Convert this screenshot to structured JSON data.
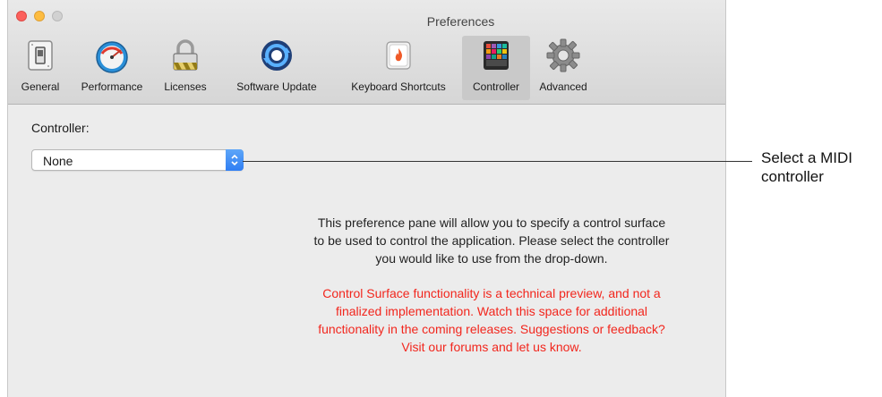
{
  "window": {
    "title": "Preferences"
  },
  "toolbar": {
    "items": [
      {
        "label": "General",
        "icon": "toggle-switch-icon"
      },
      {
        "label": "Performance",
        "icon": "speedometer-icon"
      },
      {
        "label": "Licenses",
        "icon": "padlock-icon"
      },
      {
        "label": "Software Update",
        "icon": "refresh-arrows-icon"
      },
      {
        "label": "Keyboard Shortcuts",
        "icon": "flame-keycap-icon"
      },
      {
        "label": "Controller",
        "icon": "pad-controller-icon"
      },
      {
        "label": "Advanced",
        "icon": "gear-icon"
      }
    ],
    "selected": "Controller"
  },
  "controller_pane": {
    "label": "Controller:",
    "select_value": "None",
    "info_lines": [
      "This preference pane will allow you to specify a control surface",
      "to be used to control the application. Please select the controller",
      "you would like to use from the drop-down."
    ],
    "warning_lines": [
      "Control Surface functionality is a technical preview, and not a",
      "finalized implementation.  Watch this space for additional",
      "functionality in the coming releases. Suggestions or feedback?",
      "Visit our forums and let us know."
    ],
    "warning_color": "#f2261d"
  },
  "callout": {
    "lines": [
      "Select a MIDI",
      "controller"
    ]
  },
  "colors": {
    "select_accent": "#2f7ef3",
    "selected_tab_bg": "#c9c9c9",
    "window_bg": "#ececec"
  }
}
